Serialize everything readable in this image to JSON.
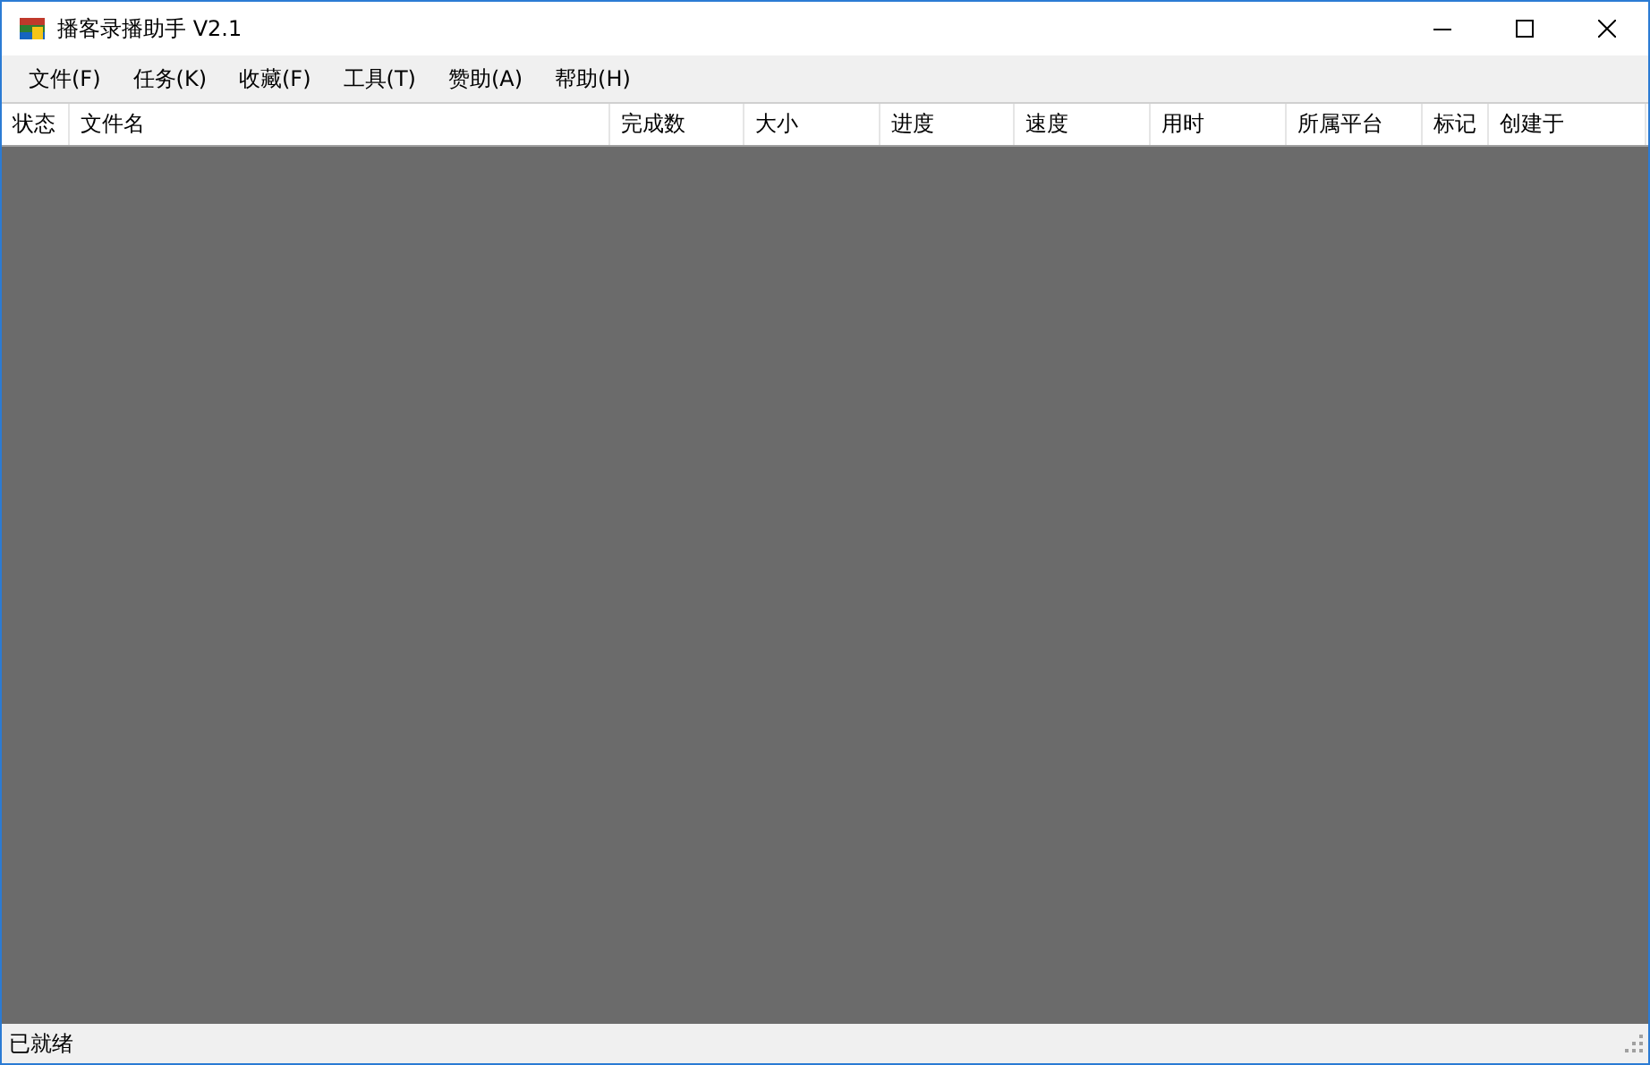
{
  "window": {
    "title": "播客录播助手 V2.1"
  },
  "menu": [
    "文件(F)",
    "任务(K)",
    "收藏(F)",
    "工具(T)",
    "赞助(A)",
    "帮助(H)"
  ],
  "table": {
    "columns": [
      "状态",
      "文件名",
      "完成数",
      "大小",
      "进度",
      "速度",
      "用时",
      "所属平台",
      "标记",
      "创建于"
    ]
  },
  "status_bar": {
    "text": "已就绪"
  }
}
